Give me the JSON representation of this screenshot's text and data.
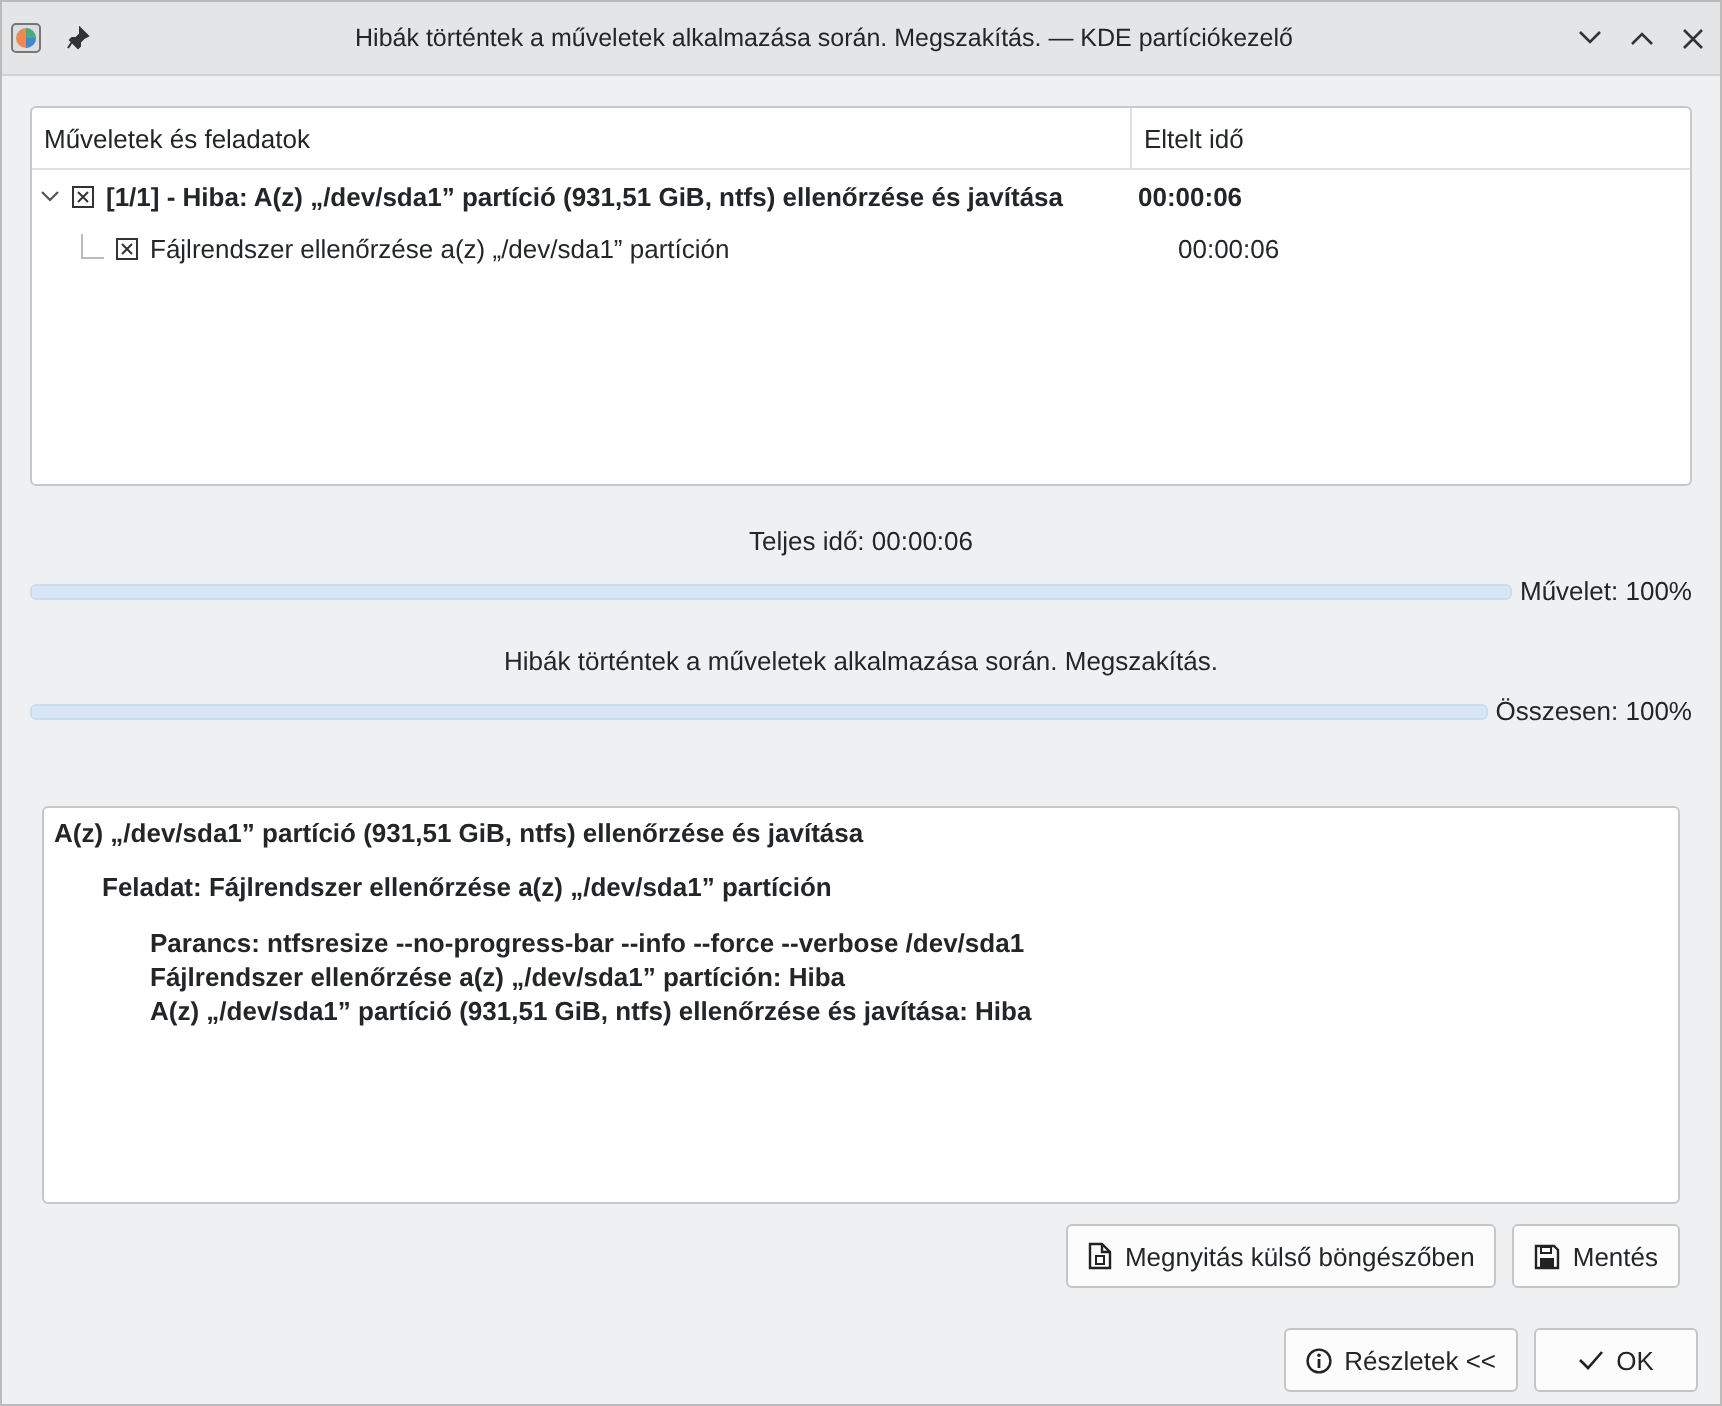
{
  "window": {
    "title": "Hibák történtek a műveletek alkalmazása során. Megszakítás. — KDE partíciókezelő"
  },
  "tree": {
    "columns": [
      "Műveletek és feladatok",
      "Eltelt idő"
    ],
    "rows": [
      {
        "label": "[1/1] - Hiba: A(z) „/dev/sda1” partíció (931,51 GiB, ntfs) ellenőrzése és javítása",
        "time": "00:00:06",
        "expanded": true,
        "children": [
          {
            "label": "Fájlrendszer ellenőrzése a(z) „/dev/sda1” partíción",
            "time": "00:00:06"
          }
        ]
      }
    ]
  },
  "total_time": "Teljes idő: 00:00:06",
  "progress": [
    {
      "level": 1,
      "reading": "Művelet: 100%"
    },
    {
      "status": "Hibák történtek a műveletek alkalmazása során. Megszakítás.",
      "level": 1,
      "reading": "Összesen: 100%"
    }
  ],
  "details": [
    {
      "text": "A(z) „/dev/sda1” partíció (931,51 GiB, ntfs) ellenőrzése és javítása",
      "children": [
        {
          "text": "Feladat: Fájlrendszer ellenőrzése a(z) „/dev/sda1” partíción",
          "children": [
            {
              "text": "Parancs: ntfsresize --no-progress-bar --info --force --verbose /dev/sda1"
            },
            {
              "text": "Fájlrendszer ellenőrzése a(z) „/dev/sda1” partíción: Hiba"
            },
            {
              "text": "A(z) „/dev/sda1” partíció (931,51 GiB, ntfs) ellenőrzése és javítása: Hiba"
            }
          ]
        }
      ]
    }
  ],
  "detail_buttons": [
    {
      "label": "Megnyitás külső böngészőben",
      "kind": "open"
    },
    {
      "label": "Mentés",
      "kind": "save"
    }
  ],
  "dialog_buttons": [
    {
      "label": "Részletek <<",
      "kind": "details"
    },
    {
      "label": "OK",
      "kind": "ok"
    }
  ]
}
